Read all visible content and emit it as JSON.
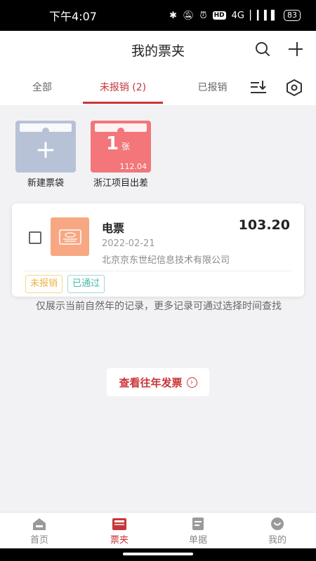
{
  "status_bar": {
    "time": "下午4:07",
    "network": "4G",
    "battery": "83"
  },
  "header": {
    "title": "我的票夹"
  },
  "tabs": [
    {
      "label": "全部"
    },
    {
      "label": "未报销 (2)"
    },
    {
      "label": "已报销"
    }
  ],
  "folders": [
    {
      "label": "新建票袋",
      "icon": "plus-icon"
    },
    {
      "label": "浙江项目出差",
      "count": "1",
      "unit": "张",
      "amount": "112.04"
    }
  ],
  "invoice": {
    "type": "电票",
    "amount": "103.20",
    "date": "2022-02-21",
    "company": "北京京东世纪信息技术有限公司",
    "tags": [
      "未报销",
      "已通过"
    ]
  },
  "notice": "仅展示当前自然年的记录，更多记录可通过选择时间查找",
  "history_button": {
    "label": "查看往年发票"
  },
  "bottom_nav": [
    {
      "label": "首页",
      "icon": "home-icon"
    },
    {
      "label": "票夹",
      "icon": "wallet-icon"
    },
    {
      "label": "单据",
      "icon": "document-icon"
    },
    {
      "label": "我的",
      "icon": "profile-icon"
    }
  ],
  "colors": {
    "accent": "#c8363a",
    "folder_new": "#b7c2d6",
    "folder_project": "#f2767a",
    "invoice_thumb": "#f7a882"
  }
}
